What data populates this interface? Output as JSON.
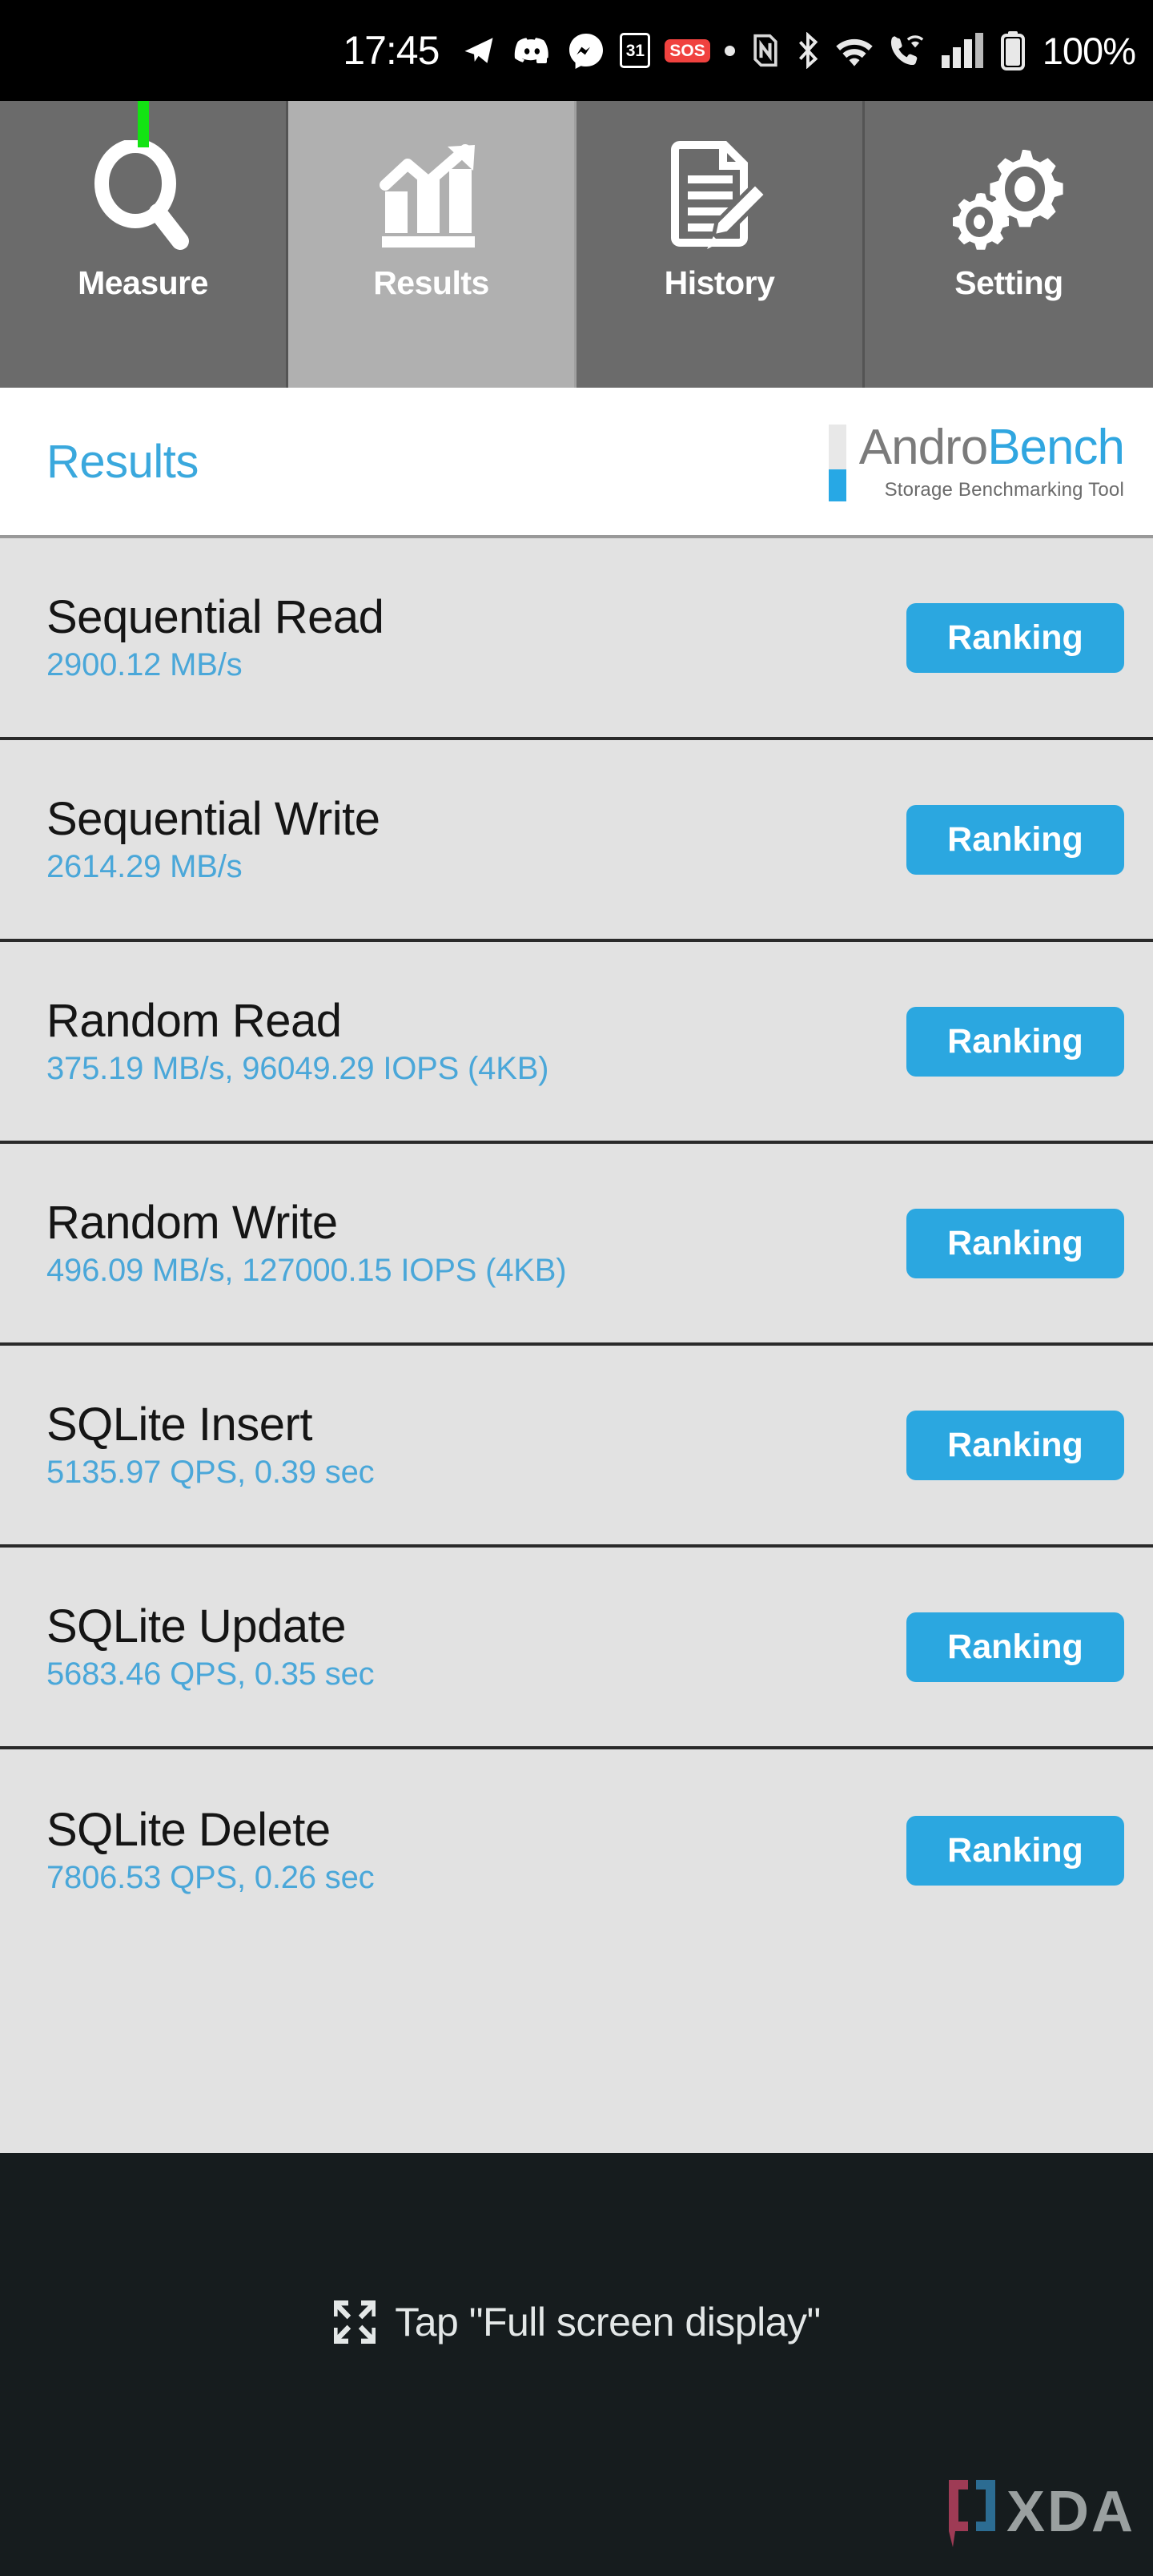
{
  "status_bar": {
    "time": "17:45",
    "battery_percent": "100%",
    "calendar_badge": "31",
    "sos_badge": "SOS",
    "icons": [
      "telegram-icon",
      "discord-icon",
      "messenger-icon",
      "calendar-icon",
      "sos-icon",
      "dot-icon",
      "nfc-icon",
      "bluetooth-icon",
      "wifi-icon",
      "wifi-calling-icon",
      "cellular-signal-icon",
      "battery-icon"
    ]
  },
  "tabs": [
    {
      "label": "Measure",
      "icon": "magnifier-icon",
      "active": false,
      "indicator": true
    },
    {
      "label": "Results",
      "icon": "bar-chart-icon",
      "active": true,
      "indicator": false
    },
    {
      "label": "History",
      "icon": "document-pencil-icon",
      "active": false,
      "indicator": false
    },
    {
      "label": "Setting",
      "icon": "gears-icon",
      "active": false,
      "indicator": false
    }
  ],
  "header": {
    "title": "Results",
    "logo": {
      "name_part1": "Andro",
      "name_part2": "Bench",
      "tagline": "Storage Benchmarking Tool"
    }
  },
  "results": {
    "ranking_label": "Ranking",
    "rows": [
      {
        "name": "Sequential Read",
        "value": "2900.12 MB/s"
      },
      {
        "name": "Sequential Write",
        "value": "2614.29 MB/s"
      },
      {
        "name": "Random Read",
        "value": "375.19 MB/s, 96049.29 IOPS (4KB)"
      },
      {
        "name": "Random Write",
        "value": "496.09 MB/s, 127000.15 IOPS (4KB)"
      },
      {
        "name": "SQLite Insert",
        "value": "5135.97 QPS, 0.39 sec"
      },
      {
        "name": "SQLite Update",
        "value": "5683.46 QPS, 0.35 sec"
      },
      {
        "name": "SQLite Delete",
        "value": "7806.53 QPS, 0.26 sec"
      }
    ]
  },
  "footer": {
    "hint": "Tap \"Full screen display\"",
    "watermark": "XDA"
  },
  "colors": {
    "accent_blue": "#2ba7e0",
    "title_blue": "#3aa8dd",
    "value_blue": "#4aa7d9",
    "tab_inactive": "#6b6b6b",
    "tab_active": "#b0b0b0",
    "list_bg": "#e2e2e2",
    "footer_bg": "#161c1e",
    "indicator_green": "#13e313",
    "sos_red": "#f0423f"
  }
}
